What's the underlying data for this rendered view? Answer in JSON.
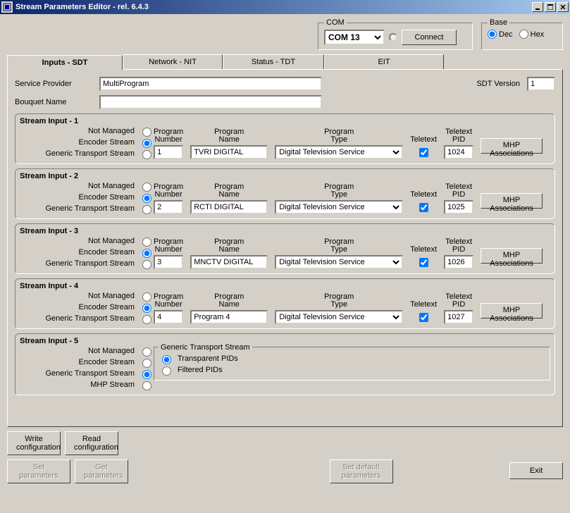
{
  "window": {
    "title": "Stream Parameters Editor - rel. 6.4.3"
  },
  "com": {
    "group_label": "COM",
    "selected": "COM 13",
    "connect_label": "Connect"
  },
  "base": {
    "group_label": "Base",
    "dec_label": "Dec",
    "hex_label": "Hex",
    "selected": "Dec"
  },
  "tabs": {
    "inputs": "Inputs - SDT",
    "network": "Network - NIT",
    "status": "Status - TDT",
    "eit": "EIT"
  },
  "form": {
    "service_provider_label": "Service Provider",
    "service_provider": "MultiProgram",
    "bouquet_name_label": "Bouquet Name",
    "bouquet_name": "",
    "sdt_version_label": "SDT Version",
    "sdt_version": "1"
  },
  "stream_labels": {
    "not_managed": "Not Managed",
    "encoder_stream": "Encoder Stream",
    "generic_transport": "Generic Transport Stream",
    "mhp_stream": "MHP Stream",
    "program_number": "Program\nNumber",
    "program_name": "Program\nName",
    "program_type": "Program\nType",
    "teletext": "Teletext",
    "teletext_pid": "Teletext\nPID",
    "mhp_assoc": "MHP\nAssociations",
    "gts_header": "Generic Transport Stream",
    "transparent_pids": "Transparent PIDs",
    "filtered_pids": "Filtered PIDs"
  },
  "streams": [
    {
      "title": "Stream Input - 1",
      "mode": "encoder",
      "prog_num": "1",
      "prog_name": "TVRI DIGITAL",
      "prog_type": "Digital Television Service",
      "teletext": true,
      "pid": "1024"
    },
    {
      "title": "Stream Input - 2",
      "mode": "encoder",
      "prog_num": "2",
      "prog_name": "RCTI DIGITAL",
      "prog_type": "Digital Television Service",
      "teletext": true,
      "pid": "1025"
    },
    {
      "title": "Stream Input - 3",
      "mode": "encoder",
      "prog_num": "3",
      "prog_name": "MNCTV DIGITAL",
      "prog_type": "Digital Television Service",
      "teletext": true,
      "pid": "1026"
    },
    {
      "title": "Stream Input - 4",
      "mode": "encoder",
      "prog_num": "4",
      "prog_name": "Program 4",
      "prog_type": "Digital Television Service",
      "teletext": true,
      "pid": "1027"
    },
    {
      "title": "Stream Input - 5",
      "mode": "generic",
      "gts_mode": "transparent"
    }
  ],
  "buttons": {
    "write_config": "Write\nconfiguration",
    "read_config": "Read\nconfiguration",
    "set_params": "Set parameters",
    "get_params": "Get\nparameters",
    "set_default": "Set default\nparameters",
    "exit": "Exit"
  }
}
